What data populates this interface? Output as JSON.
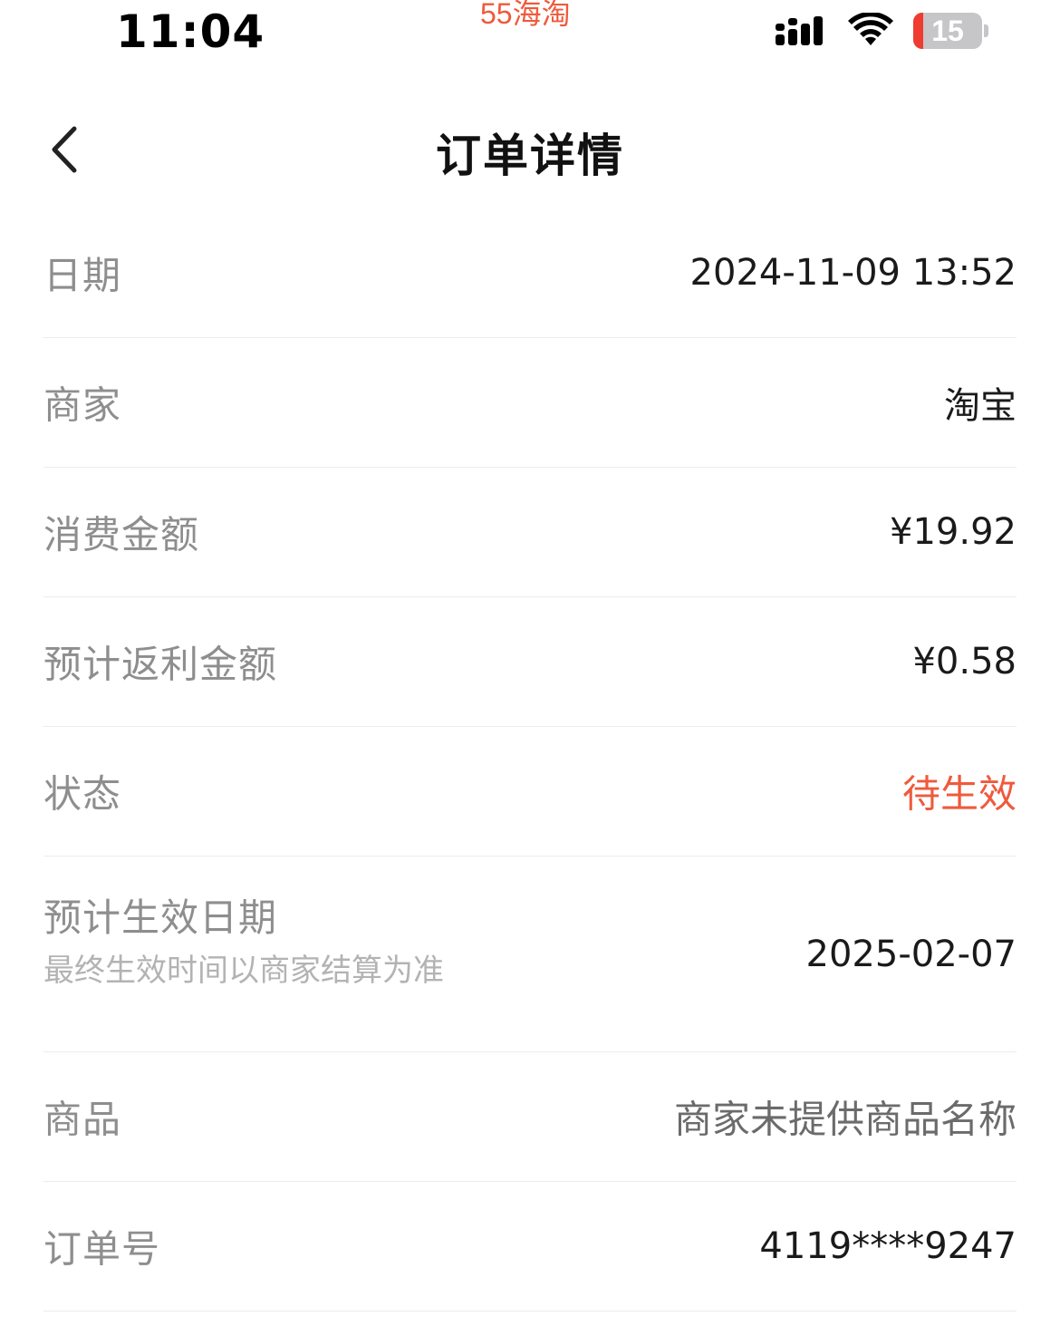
{
  "status_bar": {
    "time": "11:04",
    "app_name": "55海淘",
    "battery_level": "15",
    "battery_fraction": 0.15
  },
  "nav": {
    "title": "订单详情",
    "back_icon": "chevron-left-icon"
  },
  "details": [
    {
      "label": "日期",
      "value": "2024-11-09 13:52"
    },
    {
      "label": "商家",
      "value": "淘宝"
    },
    {
      "label": "消费金额",
      "value": "¥19.92"
    },
    {
      "label": "预计返利金额",
      "value": "¥0.58"
    },
    {
      "label": "状态",
      "value": "待生效"
    },
    {
      "label": "预计生效日期",
      "sub_label": "最终生效时间以商家结算为准",
      "value": "2025-02-07"
    },
    {
      "label": "商品",
      "value": "商家未提供商品名称"
    },
    {
      "label": "订单号",
      "value": "4119****9247"
    }
  ],
  "colors": {
    "status_accent": "#ef5a3c",
    "label_gray": "#8e8e8e",
    "divider": "#ececec"
  }
}
